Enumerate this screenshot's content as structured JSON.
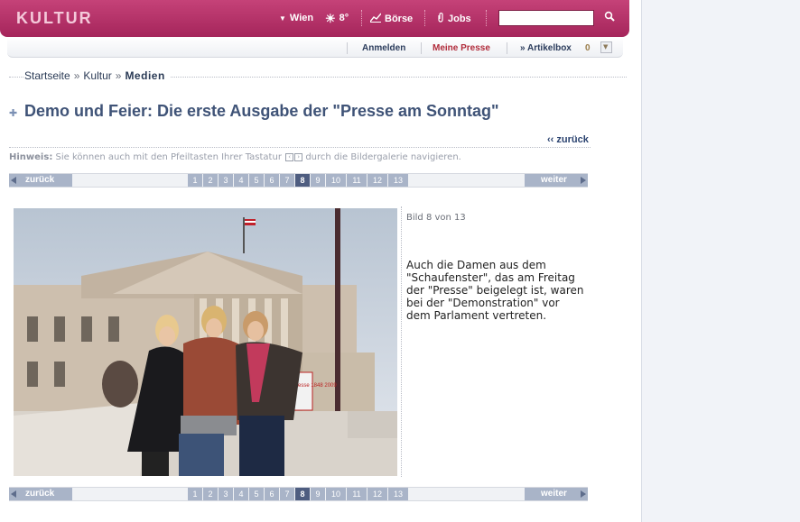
{
  "header": {
    "section": "KULTUR",
    "location": "Wien",
    "temperature": "8°",
    "boerse": "Börse",
    "jobs": "Jobs",
    "search_value": ""
  },
  "subnav": {
    "login": "Anmelden",
    "my_presse": "Meine Presse",
    "artikelbox": "» Artikelbox",
    "artikelbox_count": "0"
  },
  "breadcrumb": [
    "Startseite",
    "Kultur",
    "Medien"
  ],
  "breadcrumb_sep": "»",
  "article": {
    "title": "Demo und Feier: Die erste Ausgabe der \"Presse am Sonntag\"",
    "back_link": "‹‹ zurück"
  },
  "hint": {
    "label": "Hinweis:",
    "text_before": "Sie können auch mit den Pfeiltasten Ihrer Tastatur",
    "text_after": "durch die Bildergalerie navigieren.",
    "key_left": "‹",
    "key_right": "›"
  },
  "pager": {
    "prev": "zurück",
    "next": "weiter",
    "pages": [
      "1",
      "2",
      "3",
      "4",
      "5",
      "6",
      "7",
      "8",
      "9",
      "10",
      "11",
      "12",
      "13"
    ],
    "active": "8"
  },
  "gallery": {
    "counter": "Bild 8 von 13",
    "caption": "Auch die Damen aus dem \"Schaufenster\", das am Freitag der \"Presse\" beigelegt ist, waren bei der \"Demonstration\" vor dem Parlament vertreten.",
    "poster_text": "Presse 1848 2009"
  },
  "colors": {
    "header_bg": "#b3306a",
    "brand_text": "#f4c9da",
    "title_blue": "#3f5377",
    "pager_blue": "#a9b4c8",
    "pager_active": "#4e5d80",
    "my_presse_red": "#b02b3a"
  }
}
